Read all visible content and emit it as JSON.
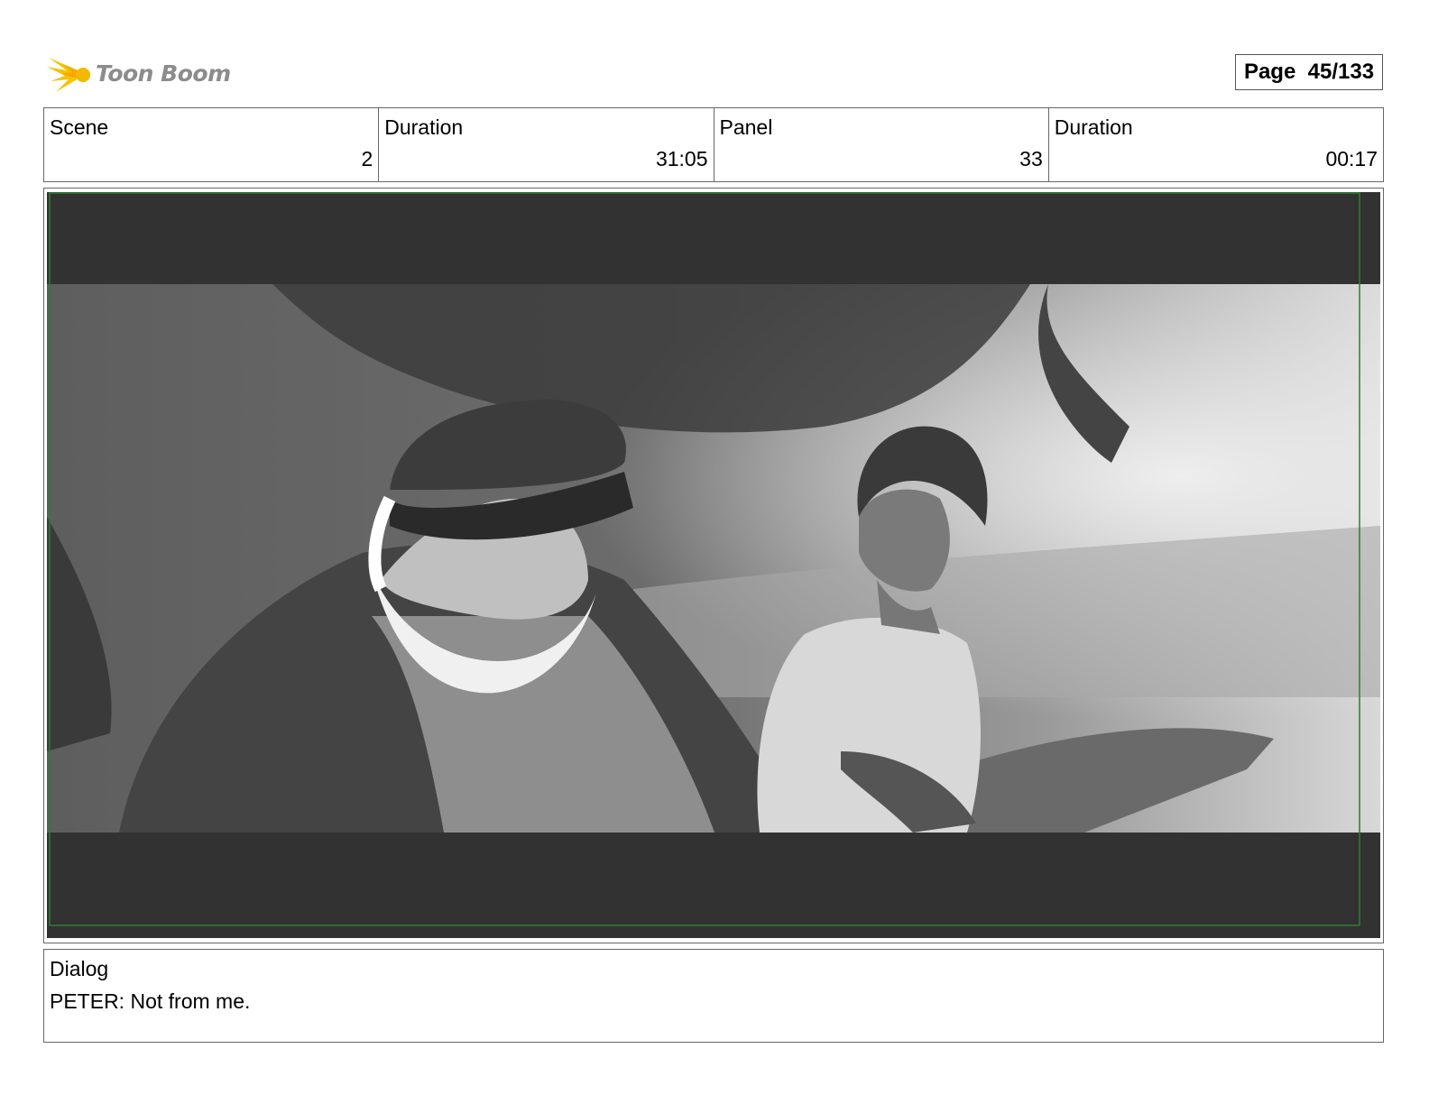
{
  "header": {
    "logo_text": "Toon Boom",
    "logo_icon": "toon-boom-burst-logo",
    "page_label": "Page",
    "page_number": "45/133"
  },
  "info": {
    "scene_label": "Scene",
    "scene_value": "2",
    "scene_duration_label": "Duration",
    "scene_duration_value": "31:05",
    "panel_label": "Panel",
    "panel_value": "33",
    "panel_duration_label": "Duration",
    "panel_duration_value": "00:17"
  },
  "panel": {
    "frame_color": "#2e7d32",
    "letterbox_color": "#323232"
  },
  "dialog": {
    "label": "Dialog",
    "text": "PETER: Not from me."
  }
}
